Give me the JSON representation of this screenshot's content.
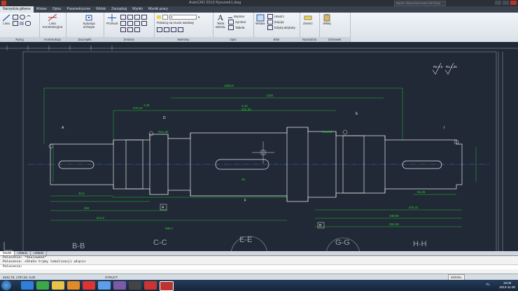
{
  "titlebar": {
    "title": "AutoCAD 2013  Rysunek1.dwg",
    "search_placeholder": "Wpisz słowo kluczowe lub frazę"
  },
  "tabs": [
    "Narzędzia główne",
    "Wstaw",
    "Opisz",
    "Parametryczne",
    "Widok",
    "Zarządzaj",
    "Wyniki",
    "Wyniki pracy"
  ],
  "ribbon": {
    "draw": {
      "title": "Rysuj",
      "tools": [
        "Linia",
        "Polilinia",
        "Okrąg",
        "Łuk"
      ]
    },
    "construct": {
      "label": "Linia Konstrukcyjna",
      "title": "Konstrukcja"
    },
    "snap": {
      "label": "Sytuacja uchwytu",
      "title": "Zaczepiki"
    },
    "modify": {
      "move_label": "Przesuń",
      "title": "Zmiana"
    },
    "layers": {
      "current": "0",
      "layer_state": "Pokazuj na rzucie warstwy",
      "title": "Warstwy"
    },
    "annotation": {
      "text_label": "Tekst wielow.",
      "dim": "Wymiar",
      "symbol": "Symbol",
      "table": "Tabela",
      "leader": "Linia odniesienia",
      "title": "Opis"
    },
    "block": {
      "insert_label": "Wstaw",
      "create": "Utwórz",
      "edit": "Edycja",
      "attrib": "Edytuj atrybuty",
      "title": "Blok"
    },
    "utils": {
      "measure_label": "Zmierz",
      "title": "Narzędzia"
    },
    "clipboard": {
      "paste_label": "Wklej",
      "title": "Schowek"
    }
  },
  "drawing": {
    "roughness": [
      "Ra 2,5",
      "Ra 1,25"
    ],
    "section_labels": [
      "B-B",
      "C-C",
      "E-E",
      "G-G",
      "H-H"
    ],
    "datums": [
      "A",
      "B"
    ],
    "callouts": [
      "A",
      "D",
      "E",
      "F",
      "I"
    ],
    "dims_top": [
      "1693,9",
      "1330",
      "275,24",
      "4,45",
      "4,40",
      "642,36",
      "10",
      "0,21",
      "0,40",
      "Ra1,25",
      "Ra1,25"
    ],
    "dims_bottom": [
      "14",
      "33,6",
      "292",
      "511,5",
      "596,7",
      "49",
      "37",
      "45",
      "273",
      "264,45",
      "249,65",
      "215,41",
      "65,45",
      "1,55",
      "3,7",
      "80"
    ]
  },
  "layout_tabs": [
    "Model",
    "Układ1",
    "Układ2"
  ],
  "command": {
    "lines": [
      "Polecenie: *Anulowane*",
      "Polecenie: <Stała tryby lokalizacji włącz>",
      "Polecenie:"
    ]
  },
  "statusbar": {
    "coords": "4642,75, 1787,52, 0,00",
    "model_label": "MODEL",
    "ortho": "STRUCT"
  },
  "taskbar": {
    "time": "15:06",
    "date": "2013-11-30",
    "lang": "PL"
  },
  "colors": {
    "drawing_bg": "#212836",
    "geometry": "#e8e8e8",
    "dimension": "#23d42a",
    "centerline": "#3a7fd0"
  }
}
